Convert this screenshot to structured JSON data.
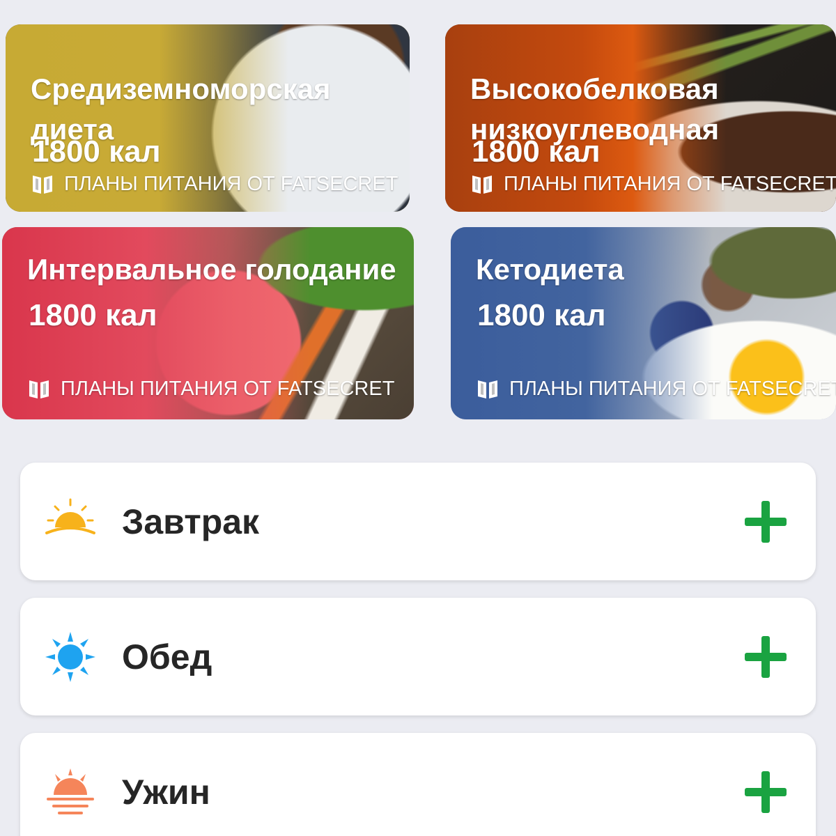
{
  "plans": [
    {
      "title_line1": "Средиземноморская",
      "title_line2": "диета",
      "calories": "1800 кал",
      "source": "ПЛАНЫ ПИТАНИЯ ОТ FATSECRET",
      "color": "#c7aa34"
    },
    {
      "title_line1": "Высокобелковая",
      "title_line2": "низкоуглеводная",
      "calories": "1800 кал",
      "source": "ПЛАНЫ ПИТАНИЯ ОТ FATSECRET",
      "color": "#c44a0e"
    },
    {
      "title_line1": "Интервальное голодание",
      "calories": "1800 кал",
      "source": "ПЛАНЫ ПИТАНИЯ ОТ FATSECRET",
      "color": "#e24a5d"
    },
    {
      "title_line1": "Кетодиета",
      "calories": "1800 кал",
      "source": "ПЛАНЫ ПИТАНИЯ ОТ FATSECRET",
      "color": "#42649f"
    }
  ],
  "meals": [
    {
      "label": "Завтрак",
      "icon": "sunrise-icon",
      "icon_color": "#f7b21b"
    },
    {
      "label": "Обед",
      "icon": "sun-icon",
      "icon_color": "#1ea3f0"
    },
    {
      "label": "Ужин",
      "icon": "sunset-icon",
      "icon_color": "#f5855a"
    }
  ],
  "accent_color": "#1aa341"
}
